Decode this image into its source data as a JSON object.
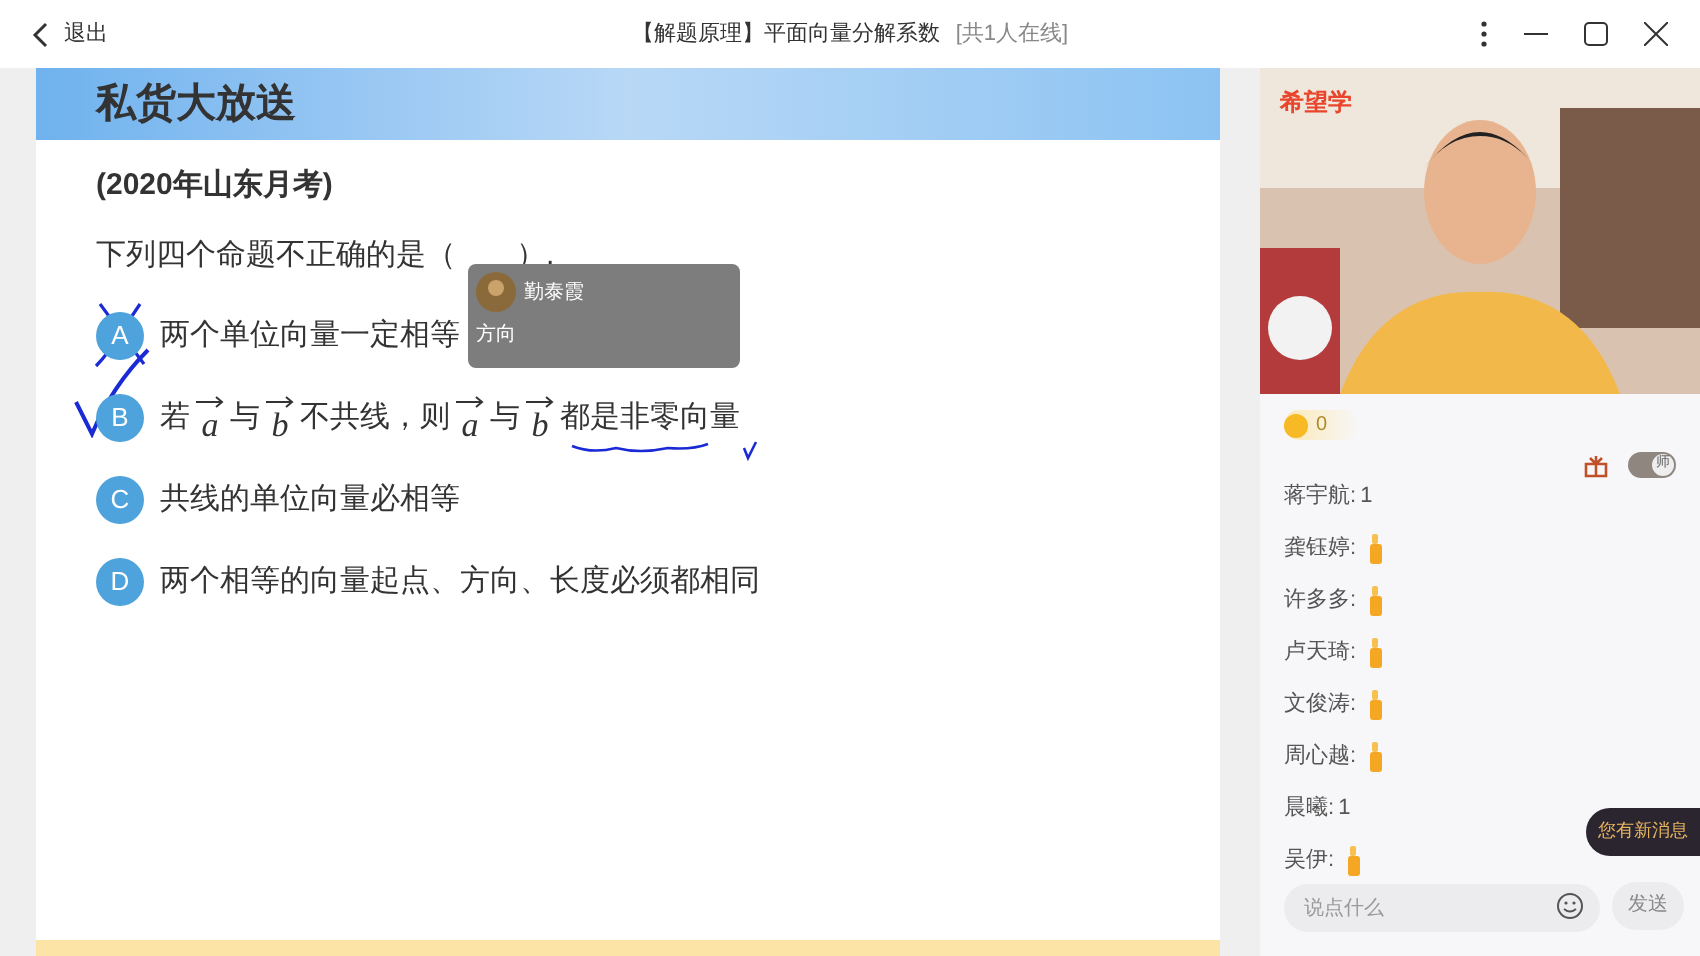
{
  "window": {
    "back": "退出",
    "title": "【解题原理】平面向量分解系数",
    "online": "[共1人在线]"
  },
  "slide": {
    "banner": "私货大放送",
    "source": "(2020年山东月考)",
    "question": "下列四个命题不正确的是（　　）.",
    "options": [
      {
        "letter": "A",
        "crossed_out": true,
        "ticked": false,
        "parts": [
          {
            "kind": "text",
            "text": "两个单位向量一定相等"
          }
        ]
      },
      {
        "letter": "B",
        "crossed_out": false,
        "ticked": true,
        "parts": [
          {
            "kind": "text",
            "text": "若"
          },
          {
            "kind": "vector",
            "text": "a"
          },
          {
            "kind": "text",
            "text": "与"
          },
          {
            "kind": "vector",
            "text": "b"
          },
          {
            "kind": "text",
            "text": "不共线，则"
          },
          {
            "kind": "vector",
            "text": "a"
          },
          {
            "kind": "text",
            "text": "与"
          },
          {
            "kind": "vector",
            "text": "b"
          },
          {
            "kind": "text",
            "text": "都是非零向量"
          }
        ]
      },
      {
        "letter": "C",
        "crossed_out": false,
        "ticked": false,
        "parts": [
          {
            "kind": "text",
            "text": "共线的单位向量必相等"
          }
        ]
      },
      {
        "letter": "D",
        "crossed_out": false,
        "ticked": false,
        "parts": [
          {
            "kind": "text",
            "text": "两个相等的向量起点、方向、长度必须都相同"
          }
        ]
      }
    ],
    "comment": {
      "user": "勤泰霞",
      "text": "方向"
    }
  },
  "side": {
    "logo": "希望学",
    "coins": "0",
    "teacher_only": {
      "label": "师",
      "on": true
    },
    "messages": [
      {
        "user": "蒋宇航:",
        "kind": "text",
        "text": "1"
      },
      {
        "user": "龚钰婷:",
        "kind": "like"
      },
      {
        "user": "许多多:",
        "kind": "like"
      },
      {
        "user": "卢天琦:",
        "kind": "like"
      },
      {
        "user": "文俊涛:",
        "kind": "like"
      },
      {
        "user": "周心越:",
        "kind": "like"
      },
      {
        "user": "晨曦:",
        "kind": "text",
        "text": "1"
      },
      {
        "user": "吴伊:",
        "kind": "like"
      }
    ],
    "new_message": "您有新消息",
    "input": {
      "placeholder": "说点什么"
    },
    "send": "发送"
  }
}
